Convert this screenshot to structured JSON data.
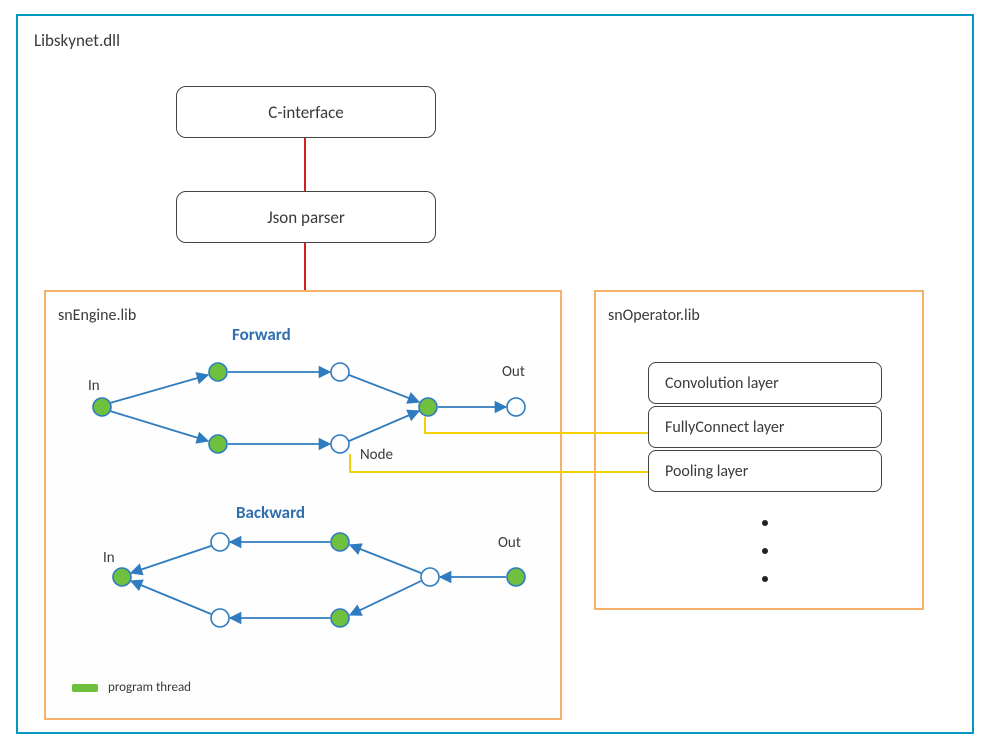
{
  "outer": {
    "title": "Libskynet.dll"
  },
  "topBoxes": {
    "cinterface": "C-interface",
    "jsonparser": "Json parser"
  },
  "engine": {
    "title": "snEngine.lib",
    "forward": "Forward",
    "backward": "Backward",
    "in": "In",
    "out": "Out",
    "node": "Node",
    "legend": "program thread"
  },
  "operator": {
    "title": "snOperator.lib",
    "layers": {
      "conv": "Convolution layer",
      "fc": "FullyConnect layer",
      "pool": "Pooling layer"
    }
  }
}
